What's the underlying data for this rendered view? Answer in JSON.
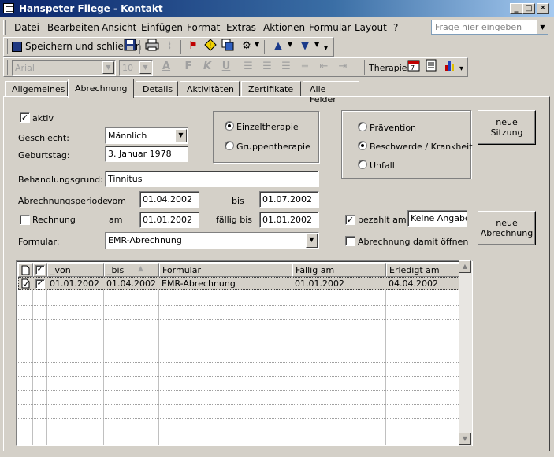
{
  "window": {
    "title": "Hanspeter Fliege - Kontakt",
    "minimize_label": "_",
    "maximize_label": "□",
    "close_label": "✕"
  },
  "menubar": {
    "items": [
      {
        "label": "Datei"
      },
      {
        "label": "Bearbeiten"
      },
      {
        "label": "Ansicht"
      },
      {
        "label": "Einfügen"
      },
      {
        "label": "Format"
      },
      {
        "label": "Extras"
      },
      {
        "label": "Aktionen"
      },
      {
        "label": "Formular"
      },
      {
        "label": "Layout"
      },
      {
        "label": "?"
      }
    ],
    "help_placeholder": "Frage hier eingeben"
  },
  "toolbar1": {
    "save_close_label": "Speichern und schließen",
    "icons": [
      "save-icon",
      "print-icon",
      "attach-icon",
      "flag-icon",
      "important-icon",
      "categories-icon",
      "options-icon",
      "previous-item-icon",
      "next-item-icon"
    ]
  },
  "toolbar2": {
    "font_name": "Arial",
    "font_size": "10",
    "bold_label": "F",
    "italic_label": "K",
    "underline_label": "U",
    "therapie_label": "Therapie"
  },
  "tabs": [
    {
      "label": "Allgemeines",
      "active": false
    },
    {
      "label": "Abrechnung",
      "active": true
    },
    {
      "label": "Details",
      "active": false
    },
    {
      "label": "Aktivitäten",
      "active": false
    },
    {
      "label": "Zertifikate",
      "active": false
    },
    {
      "label": "Alle Felder",
      "active": false
    }
  ],
  "form": {
    "aktiv_label": "aktiv",
    "aktiv_checked": true,
    "geschlecht_label": "Geschlecht:",
    "geschlecht_value": "Männlich",
    "geburtstag_label": "Geburtstag:",
    "geburtstag_value": "3. Januar 1978",
    "therapie_options": [
      {
        "label": "Einzeltherapie",
        "selected": true
      },
      {
        "label": "Gruppentherapie",
        "selected": false
      }
    ],
    "grund_options": [
      {
        "label": "Prävention",
        "selected": false
      },
      {
        "label": "Beschwerde / Krankheit",
        "selected": true
      },
      {
        "label": "Unfall",
        "selected": false
      }
    ],
    "neue_sitzung_line1": "neue",
    "neue_sitzung_line2": "Sitzung",
    "behandlungsgrund_label": "Behandlungsgrund:",
    "behandlungsgrund_value": "Tinnitus",
    "periode_label": "Abrechnungsperiode",
    "vom_label": "vom",
    "vom_value": "01.04.2002",
    "bis_label": "bis",
    "bis_value": "01.07.2002",
    "rechnung_label": "Rechnung",
    "rechnung_checked": false,
    "am_label": "am",
    "am_value": "01.01.2002",
    "faellig_label": "fällig bis",
    "faellig_value": "01.01.2002",
    "bezahlt_label": "bezahlt am",
    "bezahlt_checked": true,
    "bezahlt_value": "Keine Angabe",
    "neue_abrechnung_line1": "neue",
    "neue_abrechnung_line2": "Abrechnung",
    "formular_label": "Formular:",
    "formular_value": "EMR-Abrechnung",
    "oeffnen_label": "Abrechnung damit öffnen",
    "oeffnen_checked": false
  },
  "grid": {
    "columns": [
      "",
      "",
      "_von",
      "_bis",
      "Formular",
      "Fällig am",
      "Erledigt am"
    ],
    "sort_indicator": "▲",
    "rows": [
      {
        "von": "01.01.2002",
        "bis": "01.04.2002",
        "formular": "EMR-Abrechnung",
        "faellig": "01.01.2002",
        "erledigt": "04.04.2002",
        "checked": true
      }
    ],
    "empty_rows": 11
  }
}
